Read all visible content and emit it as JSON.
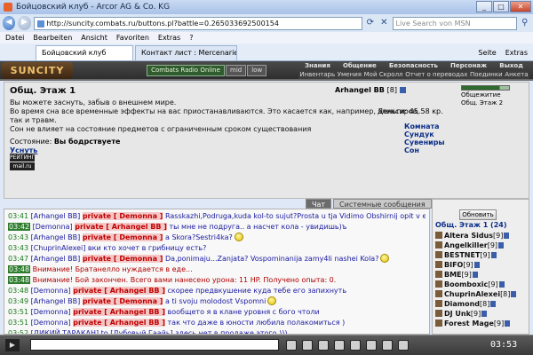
{
  "window": {
    "title": "Бойцовский клуб - Arcor AG & Co. KG"
  },
  "browser": {
    "url": "http://suncity.combats.ru/buttons.pl?battle=0.265033692500154",
    "search_placeholder": "Live Search von MSN",
    "menu": [
      "Datei",
      "Bearbeiten",
      "Ansicht",
      "Favoriten",
      "Extras",
      "?"
    ],
    "tabs": [
      {
        "label": "Бойцовский клуб",
        "active": true
      },
      {
        "label": "Контакт лист : Mercenaries",
        "active": false
      }
    ],
    "tools": [
      "Seite",
      "Extras"
    ]
  },
  "game": {
    "logo": "SUNCITY",
    "radio": "Combats Radio Online",
    "quality": [
      "mid",
      "low"
    ],
    "menu_top": [
      "Знания",
      "Общение",
      "Безопасность",
      "Персонаж",
      "Выход"
    ],
    "menu_bottom": [
      "Инвентарь",
      "Умения",
      "Мой Скролл",
      "Отчет о переводах",
      "Поединки",
      "Анкета"
    ],
    "location_title": "Общ. Этаж 1",
    "player_name": "Arhangel BB",
    "player_level": "[8]",
    "minimap": [
      "Общежитие",
      "Общ. Этаж 2"
    ],
    "description": [
      "Вы можете заснуть, забыв о внешнем мире.",
      "Во время сна все временные эффекты на вас приостанавливаются. Это касается как, например, эликсиров, так и травм.",
      "Сон не влияет на состояние предметов с ограниченным сроком существования"
    ],
    "money": "Деньги: 45.58 кр.",
    "state_label": "Состояние:",
    "state_value": "Вы бодрствуете",
    "sleep_link": "Уснуть",
    "room_links": [
      "Комната",
      "Сундук",
      "Сувениры",
      "Сон"
    ],
    "counters": [
      "РЕЙТИНГ",
      "mail.ru"
    ]
  },
  "chat": {
    "tabs": [
      "Чат",
      "Системные сообщения"
    ],
    "messages": [
      {
        "time": "03:41",
        "from": "[Arhangel BB]",
        "priv": "private [ Demonna ]",
        "text": "Rasskazhi,Podruga,kuda kol-to sujut?Prosta u tja Vidimo Obshirnij opit v etom dele",
        "smiley": true
      },
      {
        "time": "03:42",
        "from": "[Demonna]",
        "priv": "private [ Arhangel BB ]",
        "text": "ты мне не подруга.. а насчет кола - увидишь)ъ",
        "highlight": true
      },
      {
        "time": "03:43",
        "from": "[Arhangel BB]",
        "priv": "private [ Demonna ]",
        "text": "a Skora?Sestri4ka?",
        "smiley": true
      },
      {
        "time": "03:43",
        "from": "[ChuprinAlexei]",
        "priv": "",
        "text": "вки кто хочет в грибницу есть?"
      },
      {
        "time": "03:47",
        "from": "[Arhangel BB]",
        "priv": "private [ Demonna ]",
        "text": "Da,ponimaju...Zanjata? Vospominanija zamy4li nashei Kola?",
        "smiley": true
      },
      {
        "time": "03:48",
        "system": "Внимание! Братанелло нуждается в еде...",
        "highlight": true
      },
      {
        "time": "03:48",
        "system": "Внимание! Бой закончен. Всего вами нанесено урона: 11 HP. Получено опыта: 0.",
        "highlight": true
      },
      {
        "time": "03:48",
        "from": "[Demonna]",
        "priv": "private [ Arhangel BB ]",
        "text": "скорее предвкушение куда тебе его запихнуть"
      },
      {
        "time": "03:49",
        "from": "[Arhangel BB]",
        "priv": "private [ Demonna ]",
        "text": "a ti svoju molodost Vspomni",
        "smiley": true
      },
      {
        "time": "03:51",
        "from": "[Demonna]",
        "priv": "private [ Arhangel BB ]",
        "text": "вообщето я в клане уровня с бого чтоли"
      },
      {
        "time": "03:51",
        "from": "[Demonna]",
        "priv": "private [ Arhangel BB ]",
        "text": "так что даже в юности любила полакомиться )"
      },
      {
        "time": "03:52",
        "from": "[ДИКИЙ ТАРАКАН]",
        "priv": "",
        "text": "to [Дубовый Гаайь] здесь нет в продаже этого )))"
      }
    ]
  },
  "online": {
    "refresh_label": "Обновить",
    "header": "Общ. Этаж 1 (24)",
    "users": [
      {
        "name": "Altera Sidus",
        "level": "[9]"
      },
      {
        "name": "Angelkiller",
        "level": "[9]"
      },
      {
        "name": "BESTNET",
        "level": "[9]"
      },
      {
        "name": "BIFO",
        "level": "[9]"
      },
      {
        "name": "BME",
        "level": "[9]"
      },
      {
        "name": "Boomboxic",
        "level": "[9]"
      },
      {
        "name": "ChuprinAlexei",
        "level": "[8]"
      },
      {
        "name": "Diamond",
        "level": "[8]"
      },
      {
        "name": "DJ Unk",
        "level": "[9]"
      },
      {
        "name": "Forest Mage",
        "level": "[9]"
      }
    ]
  },
  "bottom": {
    "clock": "03:53"
  }
}
